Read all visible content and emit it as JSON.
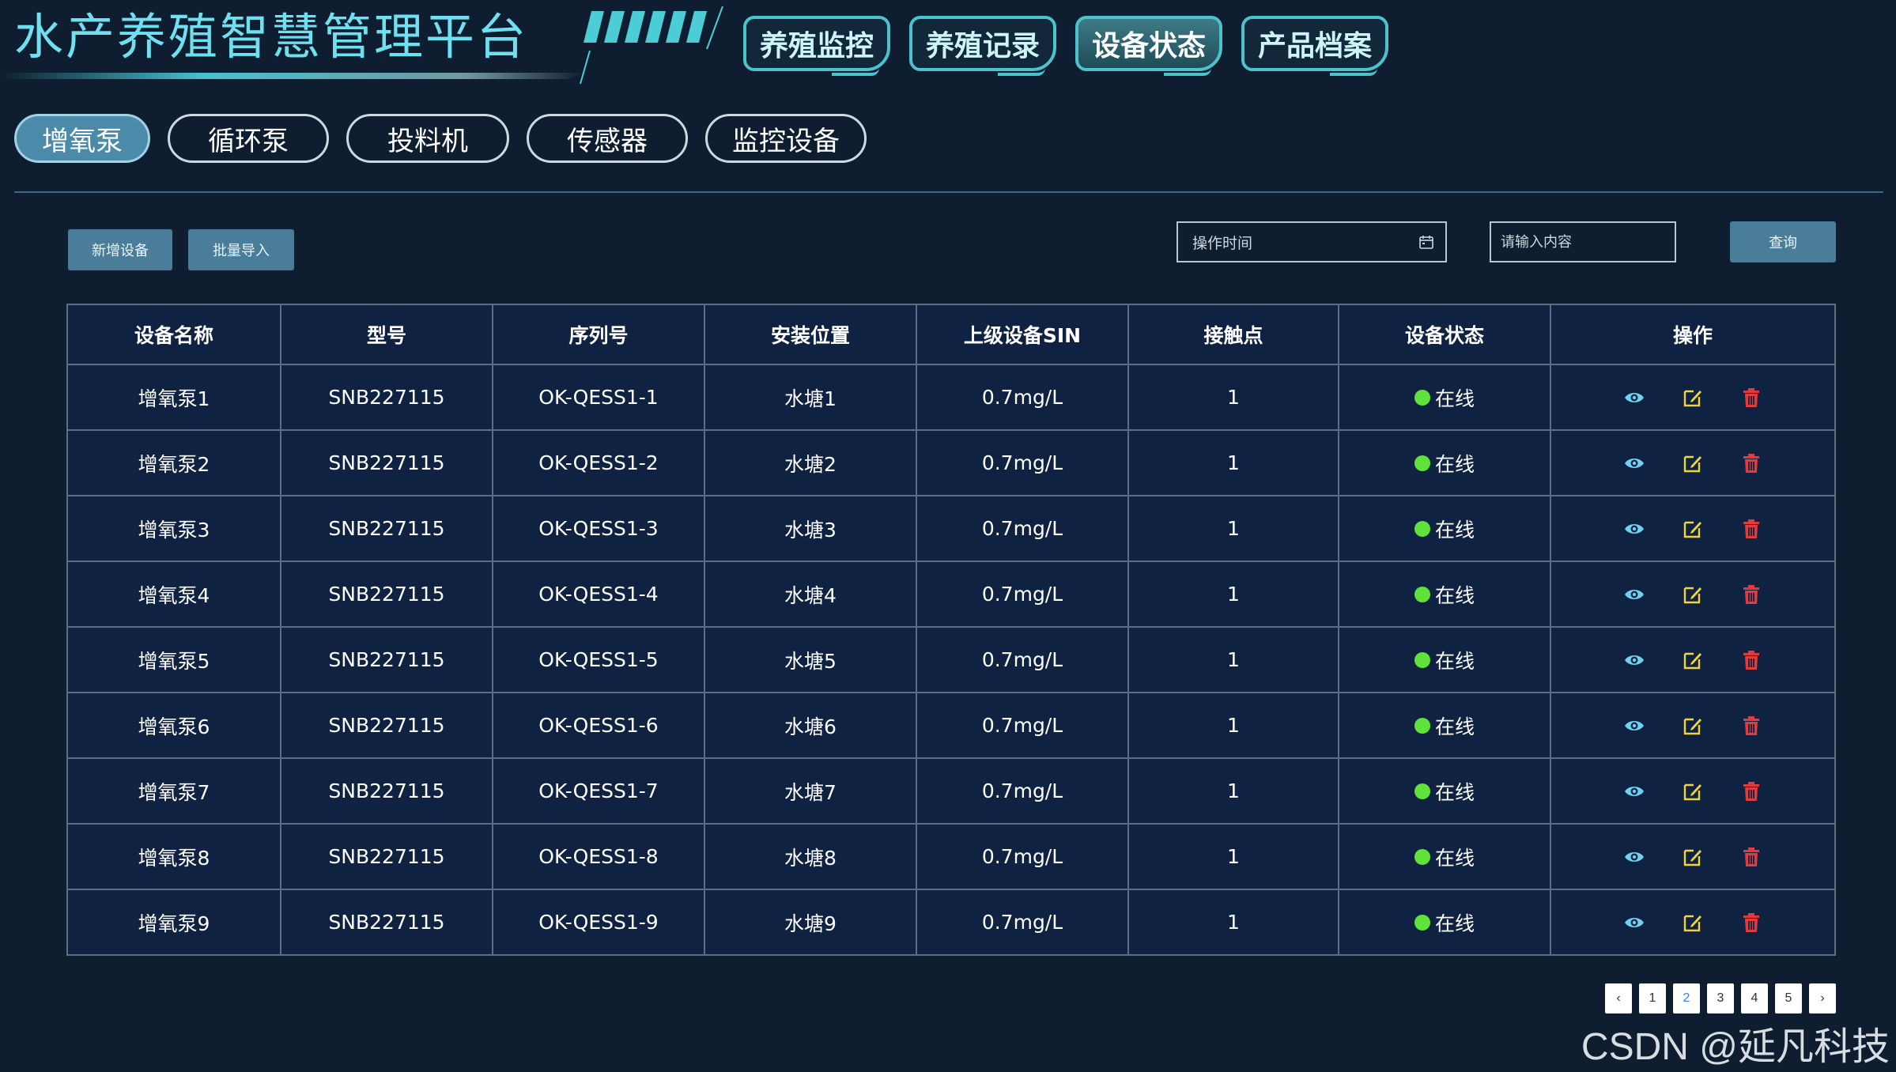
{
  "header": {
    "title": "水产养殖智慧管理平台",
    "nav_tabs": [
      {
        "label": "养殖监控",
        "active": false
      },
      {
        "label": "养殖记录",
        "active": false
      },
      {
        "label": "设备状态",
        "active": true
      },
      {
        "label": "产品档案",
        "active": false
      }
    ]
  },
  "sub_tabs": [
    {
      "label": "增氧泵",
      "active": true
    },
    {
      "label": "循环泵",
      "active": false
    },
    {
      "label": "投料机",
      "active": false
    },
    {
      "label": "传感器",
      "active": false
    },
    {
      "label": "监控设备",
      "active": false
    }
  ],
  "toolbar": {
    "add_label": "新增设备",
    "import_label": "批量导入",
    "date_placeholder": "操作时间",
    "search_placeholder": "请输入内容",
    "query_label": "查询"
  },
  "table": {
    "headers": [
      "设备名称",
      "型号",
      "序列号",
      "安装位置",
      "上级设备SIN",
      "接触点",
      "设备状态",
      "操作"
    ],
    "rows": [
      {
        "name": "增氧泵1",
        "model": "SNB227115",
        "serial": "OK-QESS1-1",
        "location": "水塘1",
        "parent_sin": "0.7mg/L",
        "contact": "1",
        "status": "在线"
      },
      {
        "name": "增氧泵2",
        "model": "SNB227115",
        "serial": "OK-QESS1-2",
        "location": "水塘2",
        "parent_sin": "0.7mg/L",
        "contact": "1",
        "status": "在线"
      },
      {
        "name": "增氧泵3",
        "model": "SNB227115",
        "serial": "OK-QESS1-3",
        "location": "水塘3",
        "parent_sin": "0.7mg/L",
        "contact": "1",
        "status": "在线"
      },
      {
        "name": "增氧泵4",
        "model": "SNB227115",
        "serial": "OK-QESS1-4",
        "location": "水塘4",
        "parent_sin": "0.7mg/L",
        "contact": "1",
        "status": "在线"
      },
      {
        "name": "增氧泵5",
        "model": "SNB227115",
        "serial": "OK-QESS1-5",
        "location": "水塘5",
        "parent_sin": "0.7mg/L",
        "contact": "1",
        "status": "在线"
      },
      {
        "name": "增氧泵6",
        "model": "SNB227115",
        "serial": "OK-QESS1-6",
        "location": "水塘6",
        "parent_sin": "0.7mg/L",
        "contact": "1",
        "status": "在线"
      },
      {
        "name": "增氧泵7",
        "model": "SNB227115",
        "serial": "OK-QESS1-7",
        "location": "水塘7",
        "parent_sin": "0.7mg/L",
        "contact": "1",
        "status": "在线"
      },
      {
        "name": "增氧泵8",
        "model": "SNB227115",
        "serial": "OK-QESS1-8",
        "location": "水塘8",
        "parent_sin": "0.7mg/L",
        "contact": "1",
        "status": "在线"
      },
      {
        "name": "增氧泵9",
        "model": "SNB227115",
        "serial": "OK-QESS1-9",
        "location": "水塘9",
        "parent_sin": "0.7mg/L",
        "contact": "1",
        "status": "在线"
      }
    ]
  },
  "pagination": {
    "prev": "‹",
    "next": "›",
    "pages": [
      "1",
      "2",
      "3",
      "4",
      "5"
    ],
    "current": "2"
  },
  "colors": {
    "status_online": "#5fe33b",
    "view_icon": "#6fd2ee",
    "edit_icon": "#f0d43a",
    "delete_icon": "#e23b3b"
  },
  "icons": {
    "view": "eye-icon",
    "edit": "edit-icon",
    "delete": "trash-icon",
    "calendar": "calendar-icon"
  },
  "watermark": "CSDN @延凡科技"
}
